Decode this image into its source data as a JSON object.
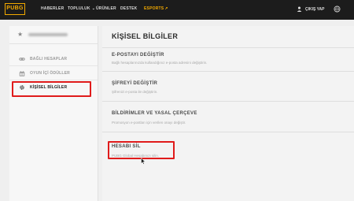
{
  "nav": {
    "logo": "PUBG",
    "links": [
      "HABERLER",
      "TOPLULUK",
      "ÜRÜNLER",
      "DESTEK",
      "ESPORTS"
    ],
    "logout": "ÇIKIŞ YAP",
    "accent": "#f2a900"
  },
  "sidebar": {
    "items": [
      {
        "label": "BAĞLI HESAPLAR",
        "icon": "link-icon"
      },
      {
        "label": "OYUN İÇİ ÖDÜLLER",
        "icon": "gift-icon"
      },
      {
        "label": "KİŞİSEL BİLGİLER",
        "icon": "gear-icon"
      }
    ]
  },
  "main": {
    "title": "KİŞİSEL BİLGİLER",
    "options": [
      {
        "title": "E-POSTAYI DEĞİŞTİR",
        "desc": "Bağlı hesaplarınızda kullandığınız e-posta adresini değiştirin."
      },
      {
        "title": "ŞİFREYİ DEĞİŞTİR",
        "desc": "Şifrenizi e-posta ile değiştirin."
      },
      {
        "title": "BİLDİRİMLER VE YASAL ÇERÇEVE",
        "desc": "Promosyon e-postları için verilen onayı değiştir."
      },
      {
        "title": "HESABI SİL",
        "desc": "PUBG Global Hesabınızı silin."
      }
    ]
  },
  "highlight_color": "#e01b1b"
}
